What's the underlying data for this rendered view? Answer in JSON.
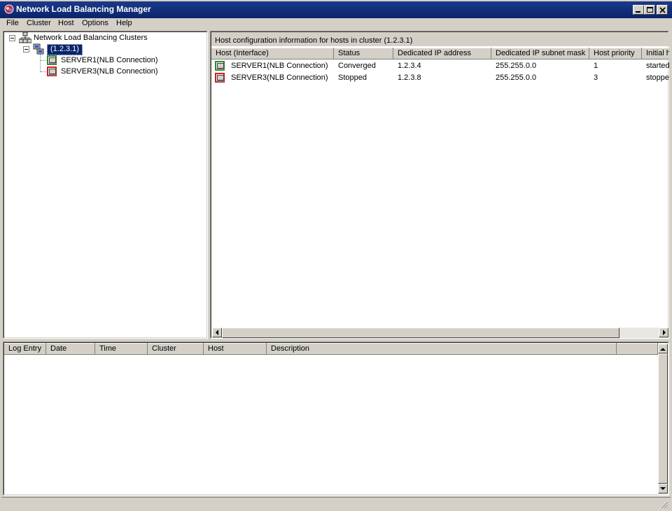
{
  "window": {
    "title": "Network Load Balancing Manager",
    "accent": "#0a246a"
  },
  "menu": [
    "File",
    "Cluster",
    "Host",
    "Options",
    "Help"
  ],
  "tree": {
    "root_label": "Network Load Balancing Clusters",
    "cluster_label": "(1.2.3.1)",
    "hosts": [
      {
        "label": "SERVER1(NLB Connection)",
        "status_color": "#2e8b2e"
      },
      {
        "label": "SERVER3(NLB Connection)",
        "status_color": "#cc2020"
      }
    ]
  },
  "host_panel": {
    "caption": "Host configuration information for hosts in cluster  (1.2.3.1)",
    "columns": [
      "Host (Interface)",
      "Status",
      "Dedicated IP address",
      "Dedicated IP subnet mask",
      "Host priority",
      "Initial h"
    ],
    "rows": [
      {
        "host": "SERVER1(NLB Connection)",
        "status": "Converged",
        "ip": "1.2.3.4",
        "mask": "255.255.0.0",
        "priority": "1",
        "initial": "started"
      },
      {
        "host": "SERVER3(NLB Connection)",
        "status": "Stopped",
        "ip": "1.2.3.8",
        "mask": "255.255.0.0",
        "priority": "3",
        "initial": "stoppe"
      }
    ]
  },
  "log_panel": {
    "columns": [
      "Log Entry",
      "Date",
      "Time",
      "Cluster",
      "Host",
      "Description"
    ]
  }
}
